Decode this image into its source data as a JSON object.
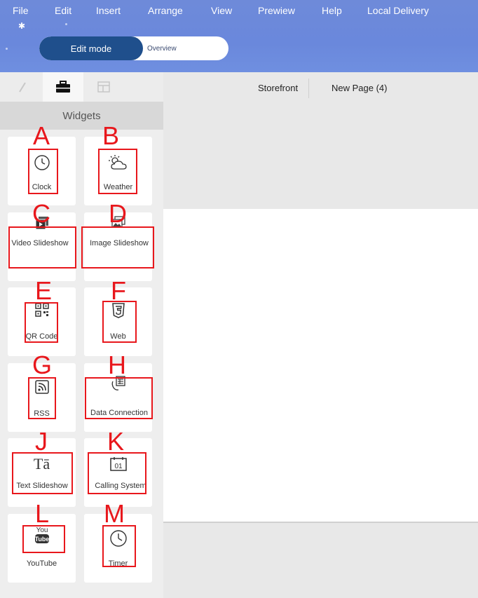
{
  "menu": [
    "File",
    "Edit",
    "Insert",
    "Arrange",
    "View",
    "Prewiew",
    "Help",
    "Local Delivery"
  ],
  "mode": {
    "edit_label": "Edit mode",
    "overview_label": "Overview"
  },
  "sidebar": {
    "tabs": [
      "pencil-icon",
      "briefcase-icon",
      "layout-icon"
    ],
    "active_tab": 1,
    "title": "Widgets"
  },
  "widgets": [
    {
      "letter": "A",
      "label": "Clock",
      "icon": "clock-icon"
    },
    {
      "letter": "B",
      "label": "Weather",
      "icon": "weather-icon"
    },
    {
      "letter": "C",
      "label": "Video Slideshow",
      "icon": "video-slideshow-icon"
    },
    {
      "letter": "D",
      "label": "Image Slideshow",
      "icon": "image-slideshow-icon"
    },
    {
      "letter": "E",
      "label": "QR Code",
      "icon": "qr-code-icon"
    },
    {
      "letter": "F",
      "label": "Web",
      "icon": "html5-icon"
    },
    {
      "letter": "G",
      "label": "RSS",
      "icon": "rss-icon"
    },
    {
      "letter": "H",
      "label": "Data Connection",
      "icon": "data-connection-icon"
    },
    {
      "letter": "J",
      "label": "Text Slideshow",
      "icon": "text-slideshow-icon"
    },
    {
      "letter": "K",
      "label": "Calling System",
      "icon": "calling-system-icon"
    },
    {
      "letter": "L",
      "label": "YouTube",
      "icon": "youtube-icon"
    },
    {
      "letter": "M",
      "label": "Timer",
      "icon": "timer-icon"
    }
  ],
  "page_tabs": [
    "Storefront",
    "New Page (4)"
  ],
  "colors": {
    "header": "#6a88dc",
    "mode_active": "#1f4f8c",
    "annotation": "#e8171c"
  }
}
